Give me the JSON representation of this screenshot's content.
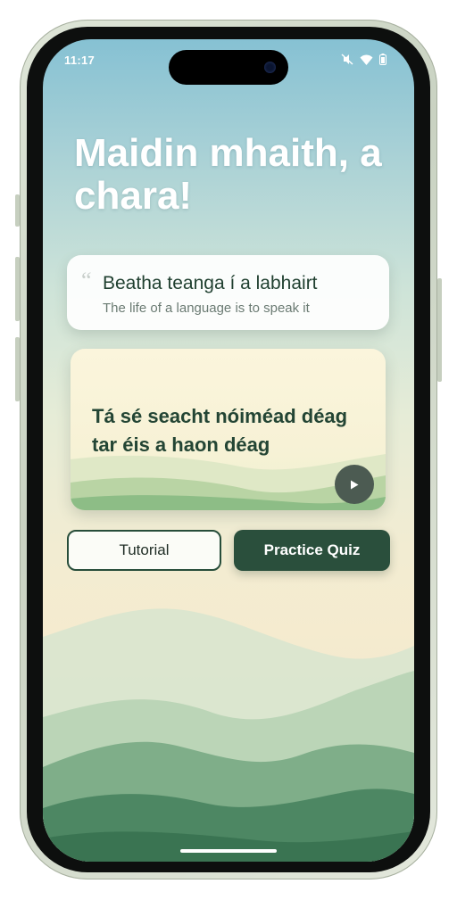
{
  "status_bar": {
    "time": "11:17",
    "icons": [
      "mute-icon",
      "wifi-icon",
      "battery-icon"
    ]
  },
  "greeting": "Maidin mhaith, a chara!",
  "proverb": {
    "quote_mark": "“",
    "irish": "Beatha teanga í a labhairt",
    "english": "The life of a language is to speak it"
  },
  "time_card": {
    "text": "Tá sé seacht nóiméad déag tar éis a haon déag",
    "play_icon": "play-icon"
  },
  "buttons": {
    "tutorial": "Tutorial",
    "practice_quiz": "Practice Quiz"
  },
  "colors": {
    "accent": "#2a4f3c",
    "text_dark": "#234534",
    "sky_top": "#86c1d3",
    "mist": "#f5ebcf"
  }
}
